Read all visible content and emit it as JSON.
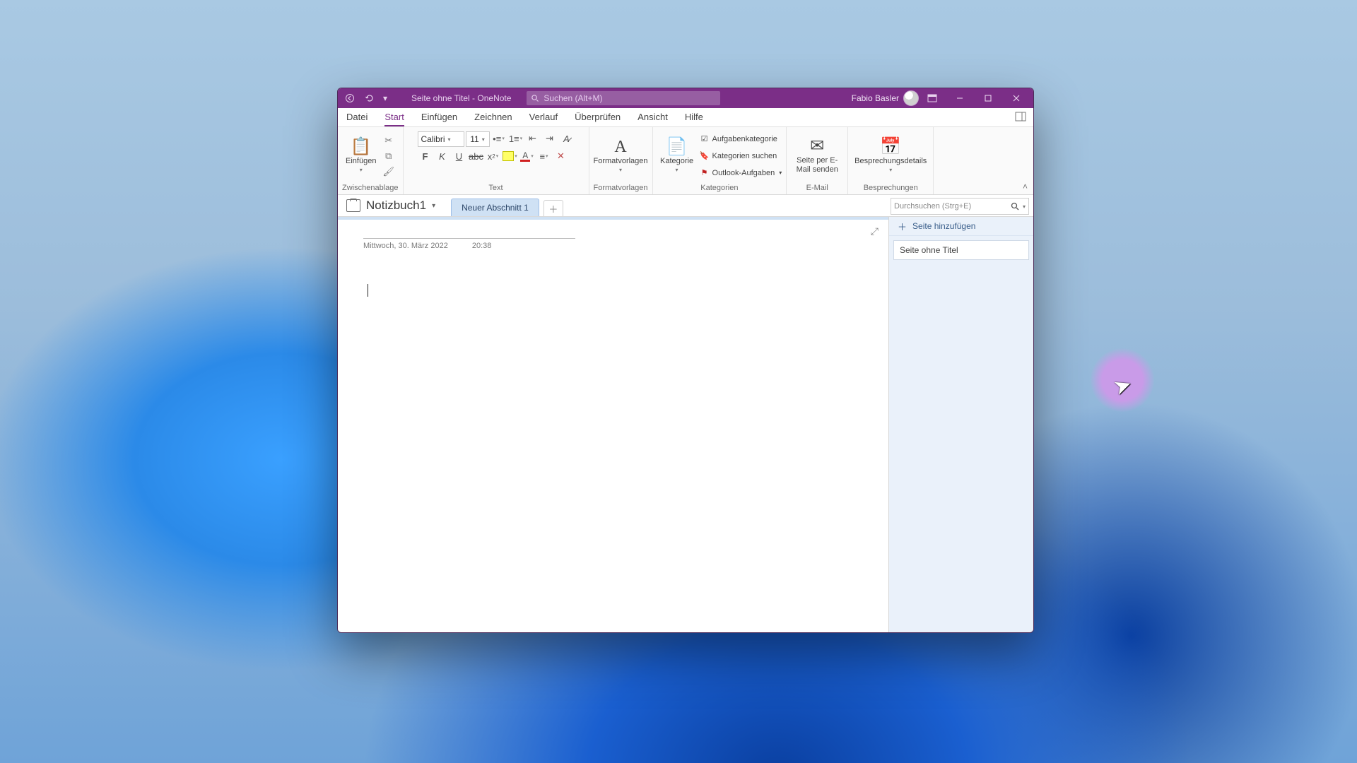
{
  "window": {
    "title": "Seite ohne Titel  -  OneNote",
    "search_placeholder": "Suchen (Alt+M)",
    "user_name": "Fabio Basler"
  },
  "tabs": {
    "datei": "Datei",
    "start": "Start",
    "einfuegen": "Einfügen",
    "zeichnen": "Zeichnen",
    "verlauf": "Verlauf",
    "ueberpruefen": "Überprüfen",
    "ansicht": "Ansicht",
    "hilfe": "Hilfe"
  },
  "ribbon": {
    "clipboard": {
      "paste": "Einfügen",
      "group": "Zwischenablage"
    },
    "text": {
      "font_name": "Calibri",
      "font_size": "11",
      "group": "Text"
    },
    "styles": {
      "btn": "Formatvorlagen",
      "group": "Formatvorlagen"
    },
    "tags": {
      "btn": "Kategorie",
      "task": "Aufgabenkategorie",
      "find": "Kategorien suchen",
      "outlook": "Outlook-Aufgaben",
      "group": "Kategorien"
    },
    "email": {
      "btn": "Seite per E-\nMail senden",
      "group": "E-Mail"
    },
    "meetings": {
      "btn": "Besprechungsdetails",
      "group": "Besprechungen"
    }
  },
  "notebook": {
    "name": "Notizbuch1",
    "section": "Neuer Abschnitt 1",
    "search_placeholder": "Durchsuchen (Strg+E)",
    "add_page": "Seite hinzufügen",
    "page_untitled": "Seite ohne Titel"
  },
  "page": {
    "date": "Mittwoch, 30. März 2022",
    "time": "20:38"
  }
}
